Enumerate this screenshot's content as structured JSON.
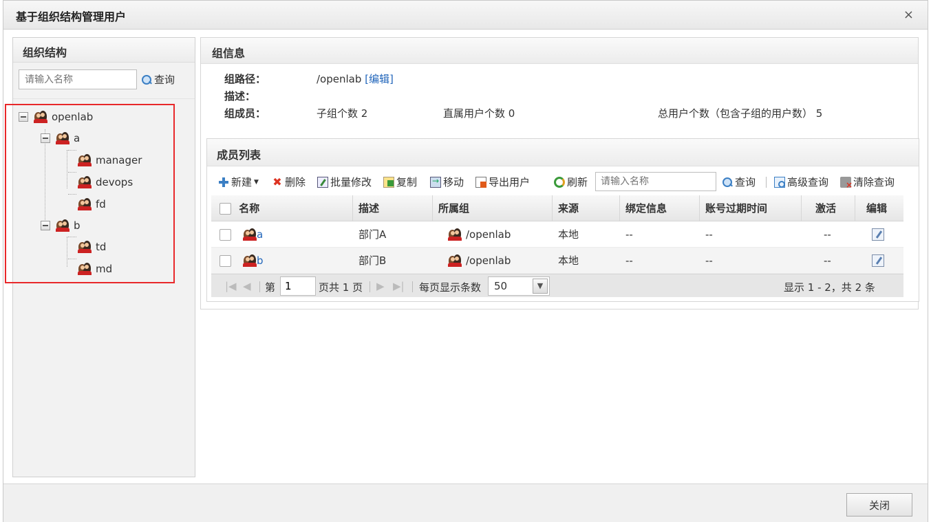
{
  "dialog": {
    "title": "基于组织结构管理用户",
    "close_glyph": "×",
    "close_button": "关闭"
  },
  "left": {
    "title": "组织结构",
    "search_placeholder": "请输入名称",
    "search_button": "查询",
    "tree": [
      {
        "label": "openlab",
        "level": 0,
        "expanded": true
      },
      {
        "label": "a",
        "level": 1,
        "expanded": true
      },
      {
        "label": "manager",
        "level": 2
      },
      {
        "label": "devops",
        "level": 2
      },
      {
        "label": "fd",
        "level": 2
      },
      {
        "label": "b",
        "level": 1,
        "expanded": true
      },
      {
        "label": "td",
        "level": 2
      },
      {
        "label": "md",
        "level": 2
      }
    ]
  },
  "info": {
    "title": "组信息",
    "path_label": "组路径：",
    "path_value": "/openlab",
    "edit_link": "[编辑]",
    "desc_label": "描述：",
    "members_label": "组成员：",
    "subgroup_count": "子组个数 2",
    "direct_user_count": "直属用户个数 0",
    "total_user_count": "总用户个数（包含子组的用户数） 5"
  },
  "members": {
    "title": "成员列表",
    "toolbar": {
      "new": "新建",
      "delete": "删除",
      "batch_edit": "批量修改",
      "copy": "复制",
      "move": "移动",
      "export": "导出用户",
      "refresh": "刷新",
      "search_placeholder": "请输入名称",
      "search": "查询",
      "advanced": "高级查询",
      "clear": "清除查询"
    },
    "columns": [
      "名称",
      "描述",
      "所属组",
      "来源",
      "绑定信息",
      "账号过期时间",
      "激活",
      "编辑"
    ],
    "rows": [
      {
        "name": "a",
        "desc": "部门A",
        "group": "/openlab",
        "source": "本地",
        "bind": "--",
        "expire": "--",
        "active": "--"
      },
      {
        "name": "b",
        "desc": "部门B",
        "group": "/openlab",
        "source": "本地",
        "bind": "--",
        "expire": "--",
        "active": "--"
      }
    ],
    "pager": {
      "page_prefix": "第",
      "page_value": "1",
      "page_suffix": "页共 1 页",
      "per_page_label": "每页显示条数",
      "per_page_value": "50",
      "summary": "显示 1 - 2，共 2 条"
    }
  }
}
